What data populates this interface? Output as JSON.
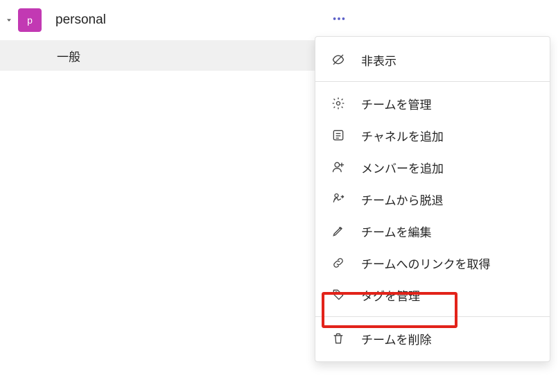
{
  "team": {
    "avatar_letter": "p",
    "name": "personal"
  },
  "channel": {
    "general_label": "一般"
  },
  "menu": {
    "hide": "非表示",
    "manage_team": "チームを管理",
    "add_channel": "チャネルを追加",
    "add_member": "メンバーを追加",
    "leave_team": "チームから脱退",
    "edit_team": "チームを編集",
    "get_link": "チームへのリンクを取得",
    "manage_tags": "タグを管理",
    "delete_team": "チームを削除"
  }
}
